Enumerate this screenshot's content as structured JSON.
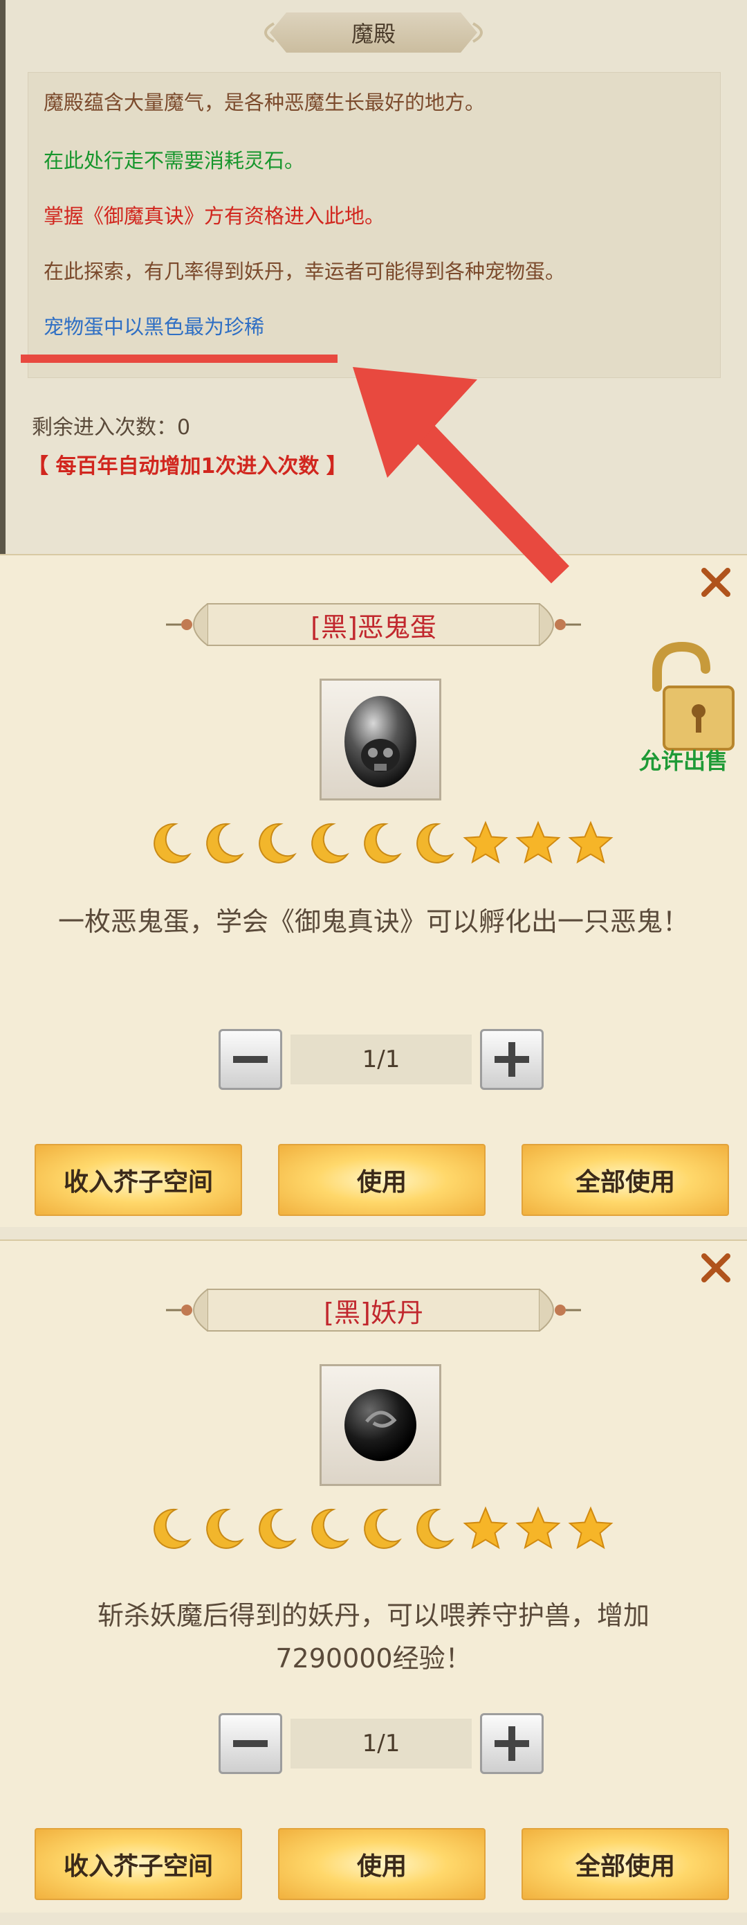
{
  "header": {
    "title": "魔殿"
  },
  "info": {
    "lines": [
      "魔殿蕴含大量魔气，是各种恶魔生长最好的地方。",
      "在此处行走不需要消耗灵石。",
      "掌握《御魔真诀》方有资格进入此地。",
      "在此探索，有几率得到妖丹，幸运者可能得到各种宠物蛋。",
      "宠物蛋中以黑色最为珍稀"
    ],
    "remaining": "剩余进入次数：0",
    "auto_increase": "【 每百年自动增加1次进入次数 】"
  },
  "items": [
    {
      "name": "[黑]恶鬼蛋",
      "sale_label": "允许出售",
      "icon": "skull-egg-icon",
      "rating": {
        "moons": 6,
        "stars": 3
      },
      "description": "一枚恶鬼蛋，学会《御鬼真诀》可以孵化出一只恶鬼！",
      "quantity": "1/1",
      "buttons": [
        "收入芥子空间",
        "使用",
        "全部使用"
      ]
    },
    {
      "name": "[黑]妖丹",
      "icon": "black-pill-icon",
      "rating": {
        "moons": 6,
        "stars": 3
      },
      "description": "斩杀妖魔后得到的妖丹，可以喂养守护兽，增加7290000经验！",
      "quantity": "1/1",
      "buttons": [
        "收入芥子空间",
        "使用",
        "全部使用"
      ]
    }
  ],
  "colors": {
    "panel_bg": "#f4ecd6",
    "item_name": "#c1272d",
    "sale_label": "#1e9a36",
    "highlight_red": "#e8493f"
  }
}
